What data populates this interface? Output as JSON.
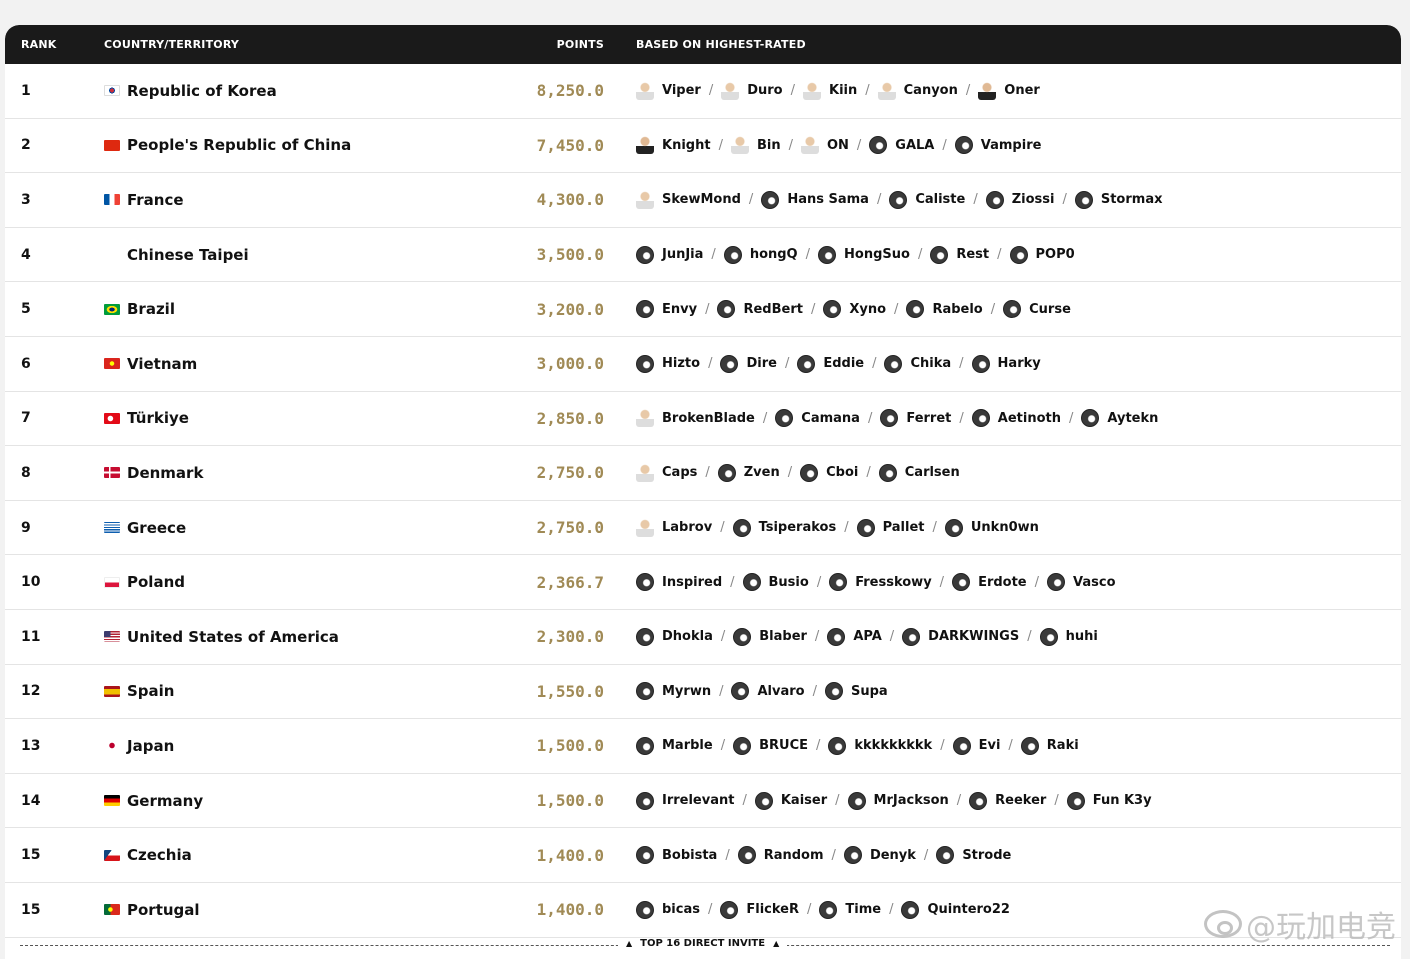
{
  "header": {
    "rank": "RANK",
    "country": "COUNTRY/TERRITORY",
    "points": "POINTS",
    "players": "BASED ON HIGHEST-RATED"
  },
  "rows": [
    {
      "rank": "1",
      "country": "Republic of Korea",
      "flag": "kr",
      "points": "8,250.0",
      "players": [
        {
          "name": "Viper",
          "avatar": "photo"
        },
        {
          "name": "Duro",
          "avatar": "photo"
        },
        {
          "name": "Kiin",
          "avatar": "photo"
        },
        {
          "name": "Canyon",
          "avatar": "photo"
        },
        {
          "name": "Oner",
          "avatar": "photo-dark"
        }
      ]
    },
    {
      "rank": "2",
      "country": "People's Republic of China",
      "flag": "cn",
      "points": "7,450.0",
      "players": [
        {
          "name": "Knight",
          "avatar": "photo-dark"
        },
        {
          "name": "Bin",
          "avatar": "photo"
        },
        {
          "name": "ON",
          "avatar": "photo"
        },
        {
          "name": "GALA",
          "avatar": "logo"
        },
        {
          "name": "Vampire",
          "avatar": "logo"
        }
      ]
    },
    {
      "rank": "3",
      "country": "France",
      "flag": "fr",
      "points": "4,300.0",
      "players": [
        {
          "name": "SkewMond",
          "avatar": "photo"
        },
        {
          "name": "Hans Sama",
          "avatar": "logo"
        },
        {
          "name": "Caliste",
          "avatar": "logo"
        },
        {
          "name": "Ziossi",
          "avatar": "logo"
        },
        {
          "name": "Stormax",
          "avatar": "logo"
        }
      ]
    },
    {
      "rank": "4",
      "country": "Chinese Taipei",
      "flag": "none",
      "points": "3,500.0",
      "players": [
        {
          "name": "JunJia",
          "avatar": "logo"
        },
        {
          "name": "hongQ",
          "avatar": "logo"
        },
        {
          "name": "HongSuo",
          "avatar": "logo"
        },
        {
          "name": "Rest",
          "avatar": "logo"
        },
        {
          "name": "POP0",
          "avatar": "logo"
        }
      ]
    },
    {
      "rank": "5",
      "country": "Brazil",
      "flag": "br",
      "points": "3,200.0",
      "players": [
        {
          "name": "Envy",
          "avatar": "logo"
        },
        {
          "name": "RedBert",
          "avatar": "logo"
        },
        {
          "name": "Xyno",
          "avatar": "logo"
        },
        {
          "name": "Rabelo",
          "avatar": "logo"
        },
        {
          "name": "Curse",
          "avatar": "logo"
        }
      ]
    },
    {
      "rank": "6",
      "country": "Vietnam",
      "flag": "vn",
      "points": "3,000.0",
      "players": [
        {
          "name": "Hizto",
          "avatar": "logo"
        },
        {
          "name": "Dire",
          "avatar": "logo"
        },
        {
          "name": "Eddie",
          "avatar": "logo"
        },
        {
          "name": "Chika",
          "avatar": "logo"
        },
        {
          "name": "Harky",
          "avatar": "logo"
        }
      ]
    },
    {
      "rank": "7",
      "country": "Türkiye",
      "flag": "tr",
      "points": "2,850.0",
      "players": [
        {
          "name": "BrokenBlade",
          "avatar": "photo"
        },
        {
          "name": "Camana",
          "avatar": "logo"
        },
        {
          "name": "Ferret",
          "avatar": "logo"
        },
        {
          "name": "Aetinoth",
          "avatar": "logo"
        },
        {
          "name": "Aytekn",
          "avatar": "logo"
        }
      ]
    },
    {
      "rank": "8",
      "country": "Denmark",
      "flag": "dk",
      "points": "2,750.0",
      "players": [
        {
          "name": "Caps",
          "avatar": "photo"
        },
        {
          "name": "Zven",
          "avatar": "logo"
        },
        {
          "name": "Cboi",
          "avatar": "logo"
        },
        {
          "name": "Carlsen",
          "avatar": "logo"
        }
      ]
    },
    {
      "rank": "9",
      "country": "Greece",
      "flag": "gr",
      "points": "2,750.0",
      "players": [
        {
          "name": "Labrov",
          "avatar": "photo"
        },
        {
          "name": "Tsiperakos",
          "avatar": "logo"
        },
        {
          "name": "Pallet",
          "avatar": "logo"
        },
        {
          "name": "Unkn0wn",
          "avatar": "logo"
        }
      ]
    },
    {
      "rank": "10",
      "country": "Poland",
      "flag": "pl",
      "points": "2,366.7",
      "players": [
        {
          "name": "Inspired",
          "avatar": "logo"
        },
        {
          "name": "Busio",
          "avatar": "logo"
        },
        {
          "name": "Fresskowy",
          "avatar": "logo"
        },
        {
          "name": "Erdote",
          "avatar": "logo"
        },
        {
          "name": "Vasco",
          "avatar": "logo"
        }
      ]
    },
    {
      "rank": "11",
      "country": "United States of America",
      "flag": "us",
      "points": "2,300.0",
      "players": [
        {
          "name": "Dhokla",
          "avatar": "logo"
        },
        {
          "name": "Blaber",
          "avatar": "logo"
        },
        {
          "name": "APA",
          "avatar": "logo"
        },
        {
          "name": "DARKWINGS",
          "avatar": "logo"
        },
        {
          "name": "huhi",
          "avatar": "logo"
        }
      ]
    },
    {
      "rank": "12",
      "country": "Spain",
      "flag": "es",
      "points": "1,550.0",
      "players": [
        {
          "name": "Myrwn",
          "avatar": "logo"
        },
        {
          "name": "Alvaro",
          "avatar": "logo"
        },
        {
          "name": "Supa",
          "avatar": "logo"
        }
      ]
    },
    {
      "rank": "13",
      "country": "Japan",
      "flag": "jp",
      "points": "1,500.0",
      "players": [
        {
          "name": "Marble",
          "avatar": "logo"
        },
        {
          "name": "BRUCE",
          "avatar": "logo"
        },
        {
          "name": "kkkkkkkkk",
          "avatar": "logo"
        },
        {
          "name": "Evi",
          "avatar": "logo"
        },
        {
          "name": "Raki",
          "avatar": "logo"
        }
      ]
    },
    {
      "rank": "14",
      "country": "Germany",
      "flag": "de",
      "points": "1,500.0",
      "players": [
        {
          "name": "Irrelevant",
          "avatar": "logo"
        },
        {
          "name": "Kaiser",
          "avatar": "logo"
        },
        {
          "name": "MrJackson",
          "avatar": "logo"
        },
        {
          "name": "Reeker",
          "avatar": "logo"
        },
        {
          "name": "Fun K3y",
          "avatar": "logo"
        }
      ]
    },
    {
      "rank": "15",
      "country": "Czechia",
      "flag": "cz",
      "points": "1,400.0",
      "players": [
        {
          "name": "Bobista",
          "avatar": "logo"
        },
        {
          "name": "Random",
          "avatar": "logo"
        },
        {
          "name": "Denyk",
          "avatar": "logo"
        },
        {
          "name": "Strode",
          "avatar": "logo"
        }
      ]
    },
    {
      "rank": "15",
      "country": "Portugal",
      "flag": "pt",
      "points": "1,400.0",
      "players": [
        {
          "name": "bicas",
          "avatar": "logo"
        },
        {
          "name": "FlickeR",
          "avatar": "logo"
        },
        {
          "name": "Time",
          "avatar": "logo"
        },
        {
          "name": "Quintero22",
          "avatar": "logo"
        }
      ]
    }
  ],
  "footer": {
    "label": "TOP 16 DIRECT INVITE"
  },
  "watermark": {
    "text": "@玩加电竞",
    "icon": "weibo-logo-icon"
  },
  "colors": {
    "header_bg": "#1a1a1a",
    "points": "#a08a55",
    "row_border": "#e4e4e4"
  }
}
